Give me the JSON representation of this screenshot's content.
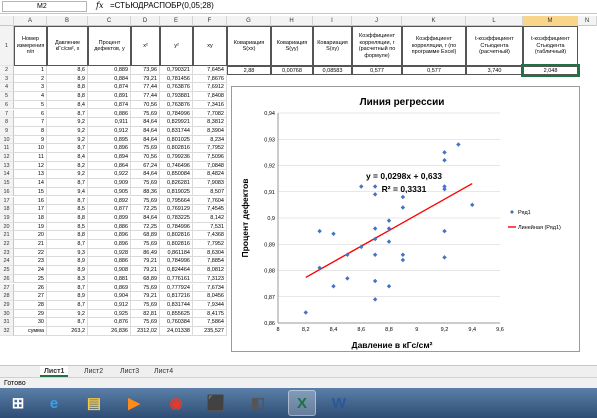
{
  "formula_bar": {
    "cell_ref": "M2",
    "fx": "fx",
    "formula": "=СТЬЮДРАСПОБР(0,05;28)"
  },
  "columns": [
    "A",
    "B",
    "C",
    "D",
    "E",
    "F",
    "G",
    "H",
    "I",
    "J",
    "K",
    "L",
    "M",
    "N"
  ],
  "selected_column": "M",
  "headers": {
    "A": "Номер измерения п/п",
    "B": "Давление кГс/см², x",
    "C": "Процент дефектов, y",
    "D": "x²",
    "E": "y²",
    "F": "xy",
    "G": "Ковариация S(xx)",
    "H": "Ковариация S(yy)",
    "I": "Ковариация S(xy)",
    "J": "Коэффициент корреляции, r (расчетный по формуле)",
    "K": "Коэффициент корреляции, r (по программе Excel)",
    "L": "t-коэффициент Стьюдента (расчетный)",
    "M": "t-коэффициент Стьюдента (табличный)"
  },
  "row2_stats": {
    "G": "2,88",
    "H": "0,00768",
    "I": "0,08583",
    "J": "0,577",
    "K": "0,577",
    "L": "3,740",
    "M": "2,048"
  },
  "rows": [
    [
      "1",
      "8,6",
      "0,889",
      "73,96",
      "0,790321",
      "7,6454"
    ],
    [
      "2",
      "8,9",
      "0,884",
      "79,21",
      "0,781456",
      "7,8676"
    ],
    [
      "3",
      "8,8",
      "0,874",
      "77,44",
      "0,763876",
      "7,6912"
    ],
    [
      "4",
      "8,8",
      "0,891",
      "77,44",
      "0,793881",
      "7,8408"
    ],
    [
      "5",
      "8,4",
      "0,874",
      "70,56",
      "0,763876",
      "7,3416"
    ],
    [
      "6",
      "8,7",
      "0,886",
      "75,69",
      "0,784996",
      "7,7082"
    ],
    [
      "7",
      "9,2",
      "0,911",
      "84,64",
      "0,829921",
      "8,3812"
    ],
    [
      "8",
      "9,2",
      "0,912",
      "84,64",
      "0,831744",
      "8,3904"
    ],
    [
      "9",
      "9,2",
      "0,895",
      "84,64",
      "0,801025",
      "8,234"
    ],
    [
      "10",
      "8,7",
      "0,896",
      "75,69",
      "0,802816",
      "7,7952"
    ],
    [
      "11",
      "8,4",
      "0,894",
      "70,56",
      "0,799236",
      "7,5096"
    ],
    [
      "12",
      "8,2",
      "0,864",
      "67,24",
      "0,746496",
      "7,0848"
    ],
    [
      "13",
      "9,2",
      "0,922",
      "84,64",
      "0,850084",
      "8,4824"
    ],
    [
      "14",
      "8,7",
      "0,909",
      "75,69",
      "0,826281",
      "7,9083"
    ],
    [
      "15",
      "9,4",
      "0,905",
      "88,36",
      "0,819025",
      "8,507"
    ],
    [
      "16",
      "8,7",
      "0,892",
      "75,69",
      "0,795664",
      "7,7604"
    ],
    [
      "17",
      "8,5",
      "0,877",
      "72,25",
      "0,769129",
      "7,4545"
    ],
    [
      "18",
      "8,8",
      "0,899",
      "84,64",
      "0,783225",
      "8,142"
    ],
    [
      "19",
      "8,5",
      "0,886",
      "72,25",
      "0,784996",
      "7,531"
    ],
    [
      "20",
      "8,8",
      "0,896",
      "68,89",
      "0,802816",
      "7,4368"
    ],
    [
      "21",
      "8,7",
      "0,896",
      "75,69",
      "0,802816",
      "7,7952"
    ],
    [
      "22",
      "9,3",
      "0,928",
      "86,49",
      "0,861184",
      "8,6304"
    ],
    [
      "23",
      "8,9",
      "0,886",
      "79,21",
      "0,784996",
      "7,8854"
    ],
    [
      "24",
      "8,9",
      "0,908",
      "79,21",
      "0,824464",
      "8,0812"
    ],
    [
      "25",
      "8,3",
      "0,881",
      "68,89",
      "0,776161",
      "7,3123"
    ],
    [
      "26",
      "8,7",
      "0,869",
      "75,69",
      "0,777924",
      "7,6734"
    ],
    [
      "27",
      "8,9",
      "0,904",
      "79,21",
      "0,817216",
      "8,0456"
    ],
    [
      "28",
      "8,7",
      "0,912",
      "75,69",
      "0,831744",
      "7,9344"
    ],
    [
      "29",
      "9,2",
      "0,925",
      "82,81",
      "0,855625",
      "8,4175"
    ],
    [
      "30",
      "8,7",
      "0,876",
      "75,69",
      "0,760384",
      "7,5864"
    ]
  ],
  "sum_row": [
    "сумма",
    "263,2",
    "26,836",
    "2312,02",
    "24,01338",
    "235,527"
  ],
  "chart_data": {
    "type": "scatter",
    "title": "Линия регрессии",
    "xlabel": "Давление в кГс/см²",
    "ylabel": "Процент дефектов",
    "xlim": [
      8,
      9.6
    ],
    "ylim": [
      0.86,
      0.94
    ],
    "xticks": [
      "8",
      "8,2",
      "8,4",
      "8,6",
      "8,8",
      "9",
      "9,2",
      "9,4",
      "9,6"
    ],
    "yticks": [
      "0,86",
      "0,87",
      "0,88",
      "0,89",
      "0,9",
      "0,91",
      "0,92",
      "0,93",
      "0,94"
    ],
    "grid": true,
    "series": [
      {
        "name": "Ряд1",
        "points": [
          [
            8.2,
            0.864
          ],
          [
            8.3,
            0.881
          ],
          [
            8.3,
            0.895
          ],
          [
            8.4,
            0.874
          ],
          [
            8.4,
            0.894
          ],
          [
            8.5,
            0.877
          ],
          [
            8.5,
            0.886
          ],
          [
            8.6,
            0.889
          ],
          [
            8.6,
            0.912
          ],
          [
            8.7,
            0.869
          ],
          [
            8.7,
            0.876
          ],
          [
            8.7,
            0.886
          ],
          [
            8.7,
            0.892
          ],
          [
            8.7,
            0.896
          ],
          [
            8.7,
            0.909
          ],
          [
            8.7,
            0.912
          ],
          [
            8.8,
            0.874
          ],
          [
            8.8,
            0.891
          ],
          [
            8.8,
            0.896
          ],
          [
            8.8,
            0.899
          ],
          [
            8.9,
            0.884
          ],
          [
            8.9,
            0.886
          ],
          [
            8.9,
            0.904
          ],
          [
            8.9,
            0.908
          ],
          [
            9.2,
            0.885
          ],
          [
            9.2,
            0.895
          ],
          [
            9.2,
            0.911
          ],
          [
            9.2,
            0.912
          ],
          [
            9.2,
            0.922
          ],
          [
            9.2,
            0.925
          ],
          [
            9.3,
            0.928
          ],
          [
            9.4,
            0.905
          ]
        ]
      },
      {
        "name": "Линейная (Ряд1)",
        "trend": {
          "slope": 0.0298,
          "intercept": 0.633,
          "x_from": 8.2,
          "x_to": 9.4
        }
      }
    ],
    "annotations": [
      "y = 0,0298x + 0,633",
      "R² = 0,3331"
    ],
    "legend_position": "right",
    "colors": {
      "points": "#4472c4",
      "trend": "#ff0000"
    }
  },
  "sheet_tabs": [
    "Лист1",
    "Лист2",
    "Лист3",
    "Лист4"
  ],
  "active_tab": "Лист1",
  "status": "Готово",
  "taskbar_icons": [
    "start-orb-icon",
    "internet-explorer-icon",
    "file-explorer-icon",
    "media-player-icon",
    "chrome-icon",
    "app-icon",
    "app-icon",
    "excel-icon",
    "word-icon"
  ]
}
